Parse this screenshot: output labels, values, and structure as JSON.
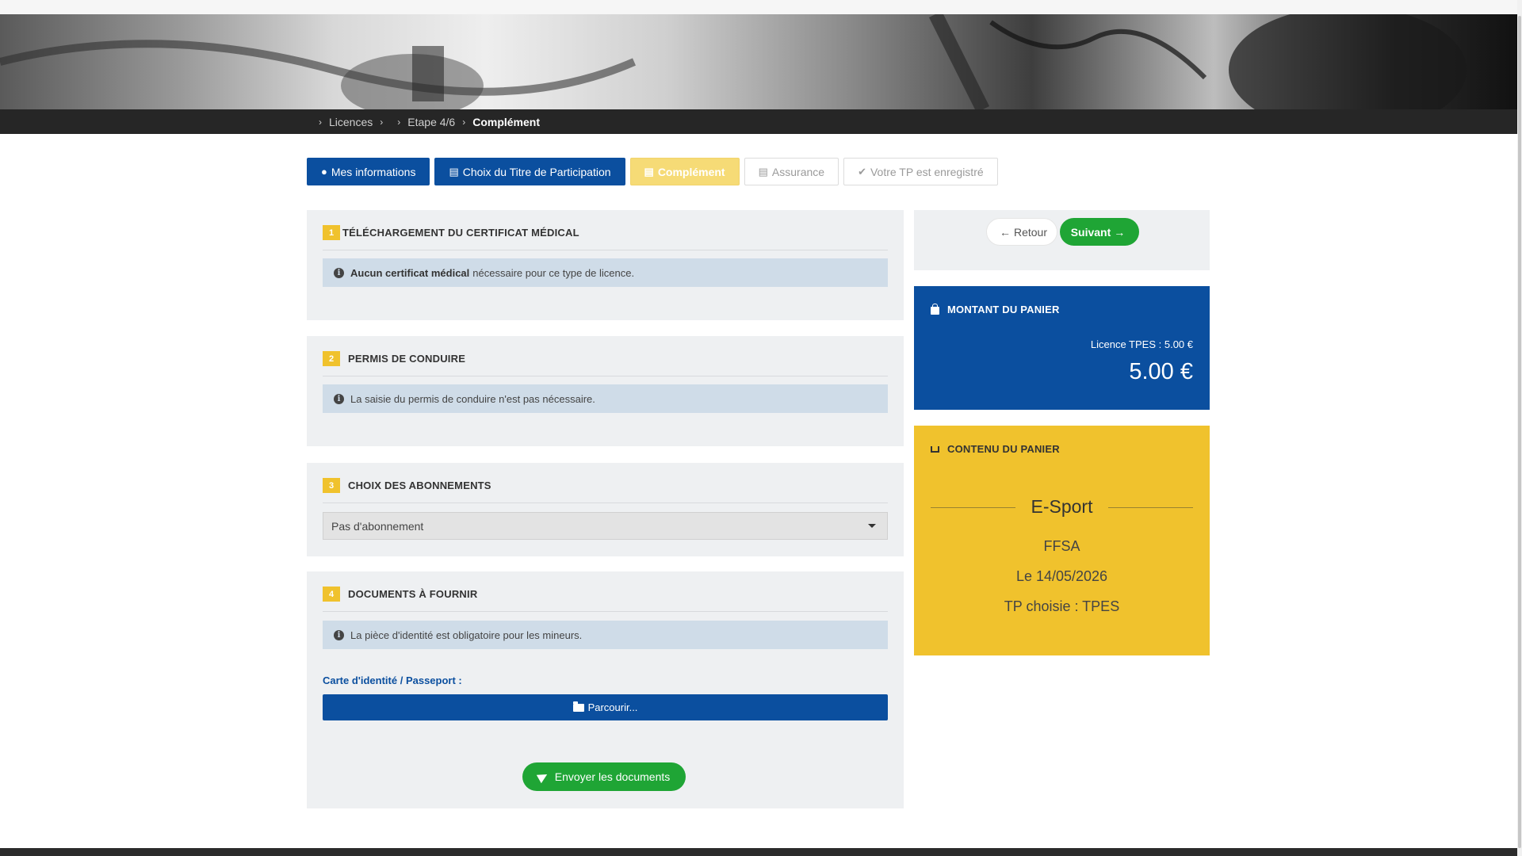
{
  "breadcrumb": {
    "items": [
      "Licences",
      "Etape 4/6"
    ],
    "current": "Complément"
  },
  "steps": [
    {
      "label": "Mes informations",
      "state": "done",
      "icon": "user-icon"
    },
    {
      "label": "Choix du Titre de Participation",
      "state": "done",
      "icon": "id-card-icon"
    },
    {
      "label": "Complément",
      "state": "active",
      "icon": "list-icon"
    },
    {
      "label": "Assurance",
      "state": "todo",
      "icon": "list-icon"
    },
    {
      "label": "Votre TP est enregistré",
      "state": "todo",
      "icon": "check-circle-icon"
    }
  ],
  "sections": {
    "certificat": {
      "number": "1",
      "title": "TÉLÉCHARGEMENT DU CERTIFICAT MÉDICAL",
      "info_bold": "Aucun certificat médical",
      "info_text": "nécessaire pour ce type de licence."
    },
    "permis": {
      "number": "2",
      "title": "PERMIS DE CONDUIRE",
      "info_text": "La saisie du permis de conduire n'est pas nécessaire."
    },
    "abonnements": {
      "number": "3",
      "title": "CHOIX DES ABONNEMENTS",
      "selected": "Pas d'abonnement"
    },
    "documents": {
      "number": "4",
      "title": "DOCUMENTS À FOURNIR",
      "info_text": "La pièce d'identité est obligatoire pour les mineurs.",
      "field_label": "Carte d'identité / Passeport :",
      "browse_label": "Parcourir...",
      "send_label": "Envoyer les documents"
    }
  },
  "nav": {
    "back_label": "Retour",
    "next_label": "Suivant"
  },
  "amount": {
    "title": "MONTANT DU PANIER",
    "line": "Licence TPES : 5.00 €",
    "total": "5.00 €"
  },
  "cart": {
    "title": "CONTENU DU PANIER",
    "item_name": "E-Sport",
    "federation": "FFSA",
    "date": "Le 14/05/2026",
    "tp": "TP choisie : TPES"
  },
  "colors": {
    "primary_blue": "#0b4f9f",
    "active_step": "#f6db76",
    "accent_yellow": "#f0c22d",
    "success_green": "#1fa535",
    "info_bg": "#cfdce8"
  }
}
